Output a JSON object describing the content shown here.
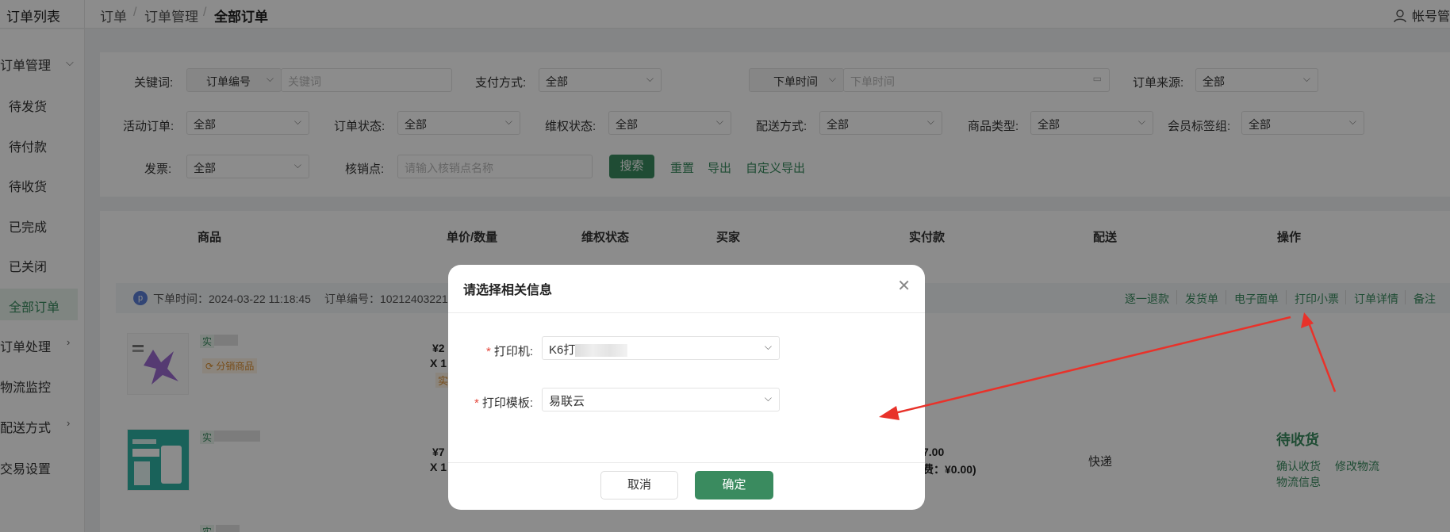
{
  "sidebar_title": "订单列表",
  "breadcrumb": [
    "订单",
    "订单管理",
    "全部订单"
  ],
  "account_label": "帐号管",
  "sidebar": {
    "group_order_mgmt": "订单管理",
    "items": [
      "待发货",
      "待付款",
      "待收货",
      "已完成",
      "已关闭",
      "全部订单"
    ],
    "order_processing": "订单处理",
    "logistics_monitor": "物流监控",
    "delivery_methods": "配送方式",
    "trade_settings": "交易设置"
  },
  "filters": {
    "keyword_label": "关键词:",
    "keyword_type": "订单编号",
    "keyword_placeholder": "关键词",
    "pay_label": "支付方式:",
    "pay_value": "全部",
    "time_type": "下单时间",
    "time_placeholder": "下单时间",
    "source_label": "订单来源:",
    "source_value": "全部",
    "activity_label": "活动订单:",
    "activity_value": "全部",
    "status_label": "订单状态:",
    "status_value": "全部",
    "rights_label": "维权状态:",
    "rights_value": "全部",
    "delivery_label": "配送方式:",
    "delivery_value": "全部",
    "goods_type_label": "商品类型:",
    "goods_type_value": "全部",
    "member_tag_label": "会员标签组:",
    "member_tag_value": "全部",
    "invoice_label": "发票:",
    "invoice_value": "全部",
    "verify_label": "核销点:",
    "verify_placeholder": "请输入核销点名称",
    "search_btn": "搜索",
    "reset_link": "重置",
    "export_link": "导出",
    "custom_export_link": "自定义导出"
  },
  "table": {
    "headers": [
      "商品",
      "单价/数量",
      "维权状态",
      "买家",
      "实付款",
      "配送",
      "操作"
    ],
    "order_time": "下单时间：2024-03-22 11:18:45",
    "order_no": "订单编号：10212403221",
    "actions": [
      "逐一退款",
      "发货单",
      "电子面单",
      "打印小票",
      "订单详情",
      "备注"
    ],
    "row1": {
      "tag": "实",
      "badge": "分销商品",
      "price": "¥2",
      "qty": "X 1",
      "flag": "实"
    },
    "row2": {
      "tag": "实",
      "price": "¥7",
      "qty": "X 1",
      "paid": "7.00",
      "paid_note": "费：¥0.00)",
      "delivery": "快递",
      "status": "待收货",
      "ops": [
        "确认收货",
        "修改物流",
        "物流信息"
      ]
    },
    "row3": {
      "tag": "实"
    }
  },
  "modal": {
    "title": "请选择相关信息",
    "printer_label": "打印机:",
    "printer_value": "K6打",
    "template_label": "打印模板:",
    "template_value": "易联云",
    "cancel_btn": "取消",
    "ok_btn": "确定"
  },
  "colors": {
    "accent": "#3a8b5f",
    "annotation_arrow": "#e8322a",
    "required": "#e5483d"
  }
}
